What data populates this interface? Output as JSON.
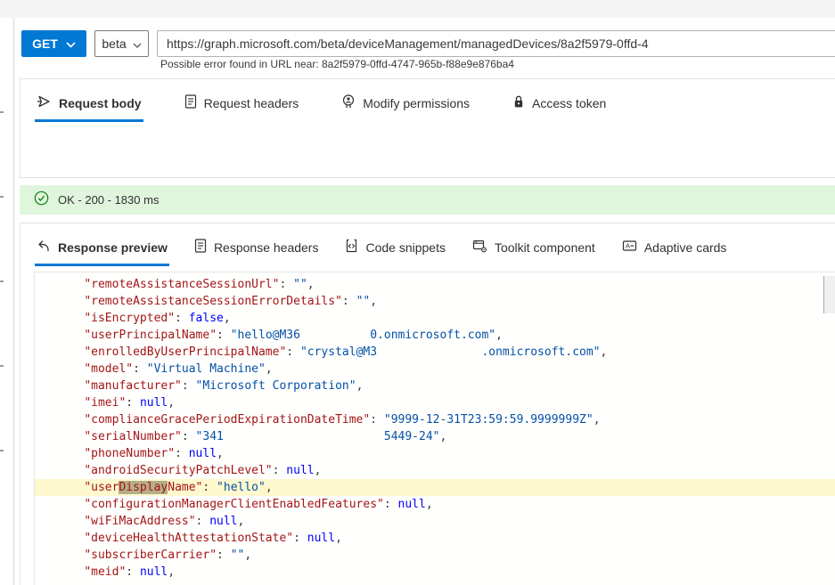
{
  "request_bar": {
    "method": "GET",
    "version": "beta",
    "url": "https://graph.microsoft.com/beta/deviceManagement/managedDevices/8a2f5979-0ffd-4",
    "url_hint": "Possible error found in URL near: 8a2f5979-0ffd-4747-965b-f88e9e876ba4"
  },
  "request_tabs": [
    {
      "label": "Request body",
      "icon": "send-icon",
      "active": true
    },
    {
      "label": "Request headers",
      "icon": "document-icon",
      "active": false
    },
    {
      "label": "Modify permissions",
      "icon": "person-permissions-icon",
      "active": false
    },
    {
      "label": "Access token",
      "icon": "lock-icon",
      "active": false
    }
  ],
  "status": {
    "label": "OK - 200 - 1830 ms",
    "icon": "success-check-icon"
  },
  "response_tabs": [
    {
      "label": "Response preview",
      "icon": "undo-arrow-icon",
      "active": true
    },
    {
      "label": "Response headers",
      "icon": "document-icon",
      "active": false
    },
    {
      "label": "Code snippets",
      "icon": "code-brackets-icon",
      "active": false
    },
    {
      "label": "Toolkit component",
      "icon": "component-gear-icon",
      "active": false
    },
    {
      "label": "Adaptive cards",
      "icon": "card-icon",
      "active": false
    }
  ],
  "colors": {
    "accent": "#0078d4",
    "success_bg": "#dff6dd",
    "success_icon": "#107c10",
    "json_key": "#a31515",
    "json_string": "#0451a5",
    "json_keyword": "#0000ff",
    "highlight_line": "#fdf8cd",
    "highlight_match": "#b6ae88"
  },
  "response_json": {
    "indent": "    ",
    "lines": [
      {
        "key": "remoteAssistanceSessionUrl",
        "value": "\"\""
      },
      {
        "key": "remoteAssistanceSessionErrorDetails",
        "value": "\"\""
      },
      {
        "key": "isEncrypted",
        "value": "false"
      },
      {
        "key": "userPrincipalName",
        "value": "\"hello@M36          0.onmicrosoft.com\""
      },
      {
        "key": "enrolledByUserPrincipalName",
        "value": "\"crystal@M3               .onmicrosoft.com\""
      },
      {
        "key": "model",
        "value": "\"Virtual Machine\""
      },
      {
        "key": "manufacturer",
        "value": "\"Microsoft Corporation\""
      },
      {
        "key": "imei",
        "value": "null"
      },
      {
        "key": "complianceGracePeriodExpirationDateTime",
        "value": "\"9999-12-31T23:59:59.9999999Z\""
      },
      {
        "key": "serialNumber",
        "value": "\"341                       5449-24\""
      },
      {
        "key": "phoneNumber",
        "value": "null"
      },
      {
        "key": "androidSecurityPatchLevel",
        "value": "null"
      },
      {
        "key_pre": "user",
        "key_match": "Display",
        "key_post": "Name",
        "value": "\"hello\"",
        "highlighted": true
      },
      {
        "key": "configurationManagerClientEnabledFeatures",
        "value": "null"
      },
      {
        "key": "wiFiMacAddress",
        "value": "null"
      },
      {
        "key": "deviceHealthAttestationState",
        "value": "null"
      },
      {
        "key": "subscriberCarrier",
        "value": "\"\""
      },
      {
        "key": "meid",
        "value": "null"
      }
    ]
  }
}
